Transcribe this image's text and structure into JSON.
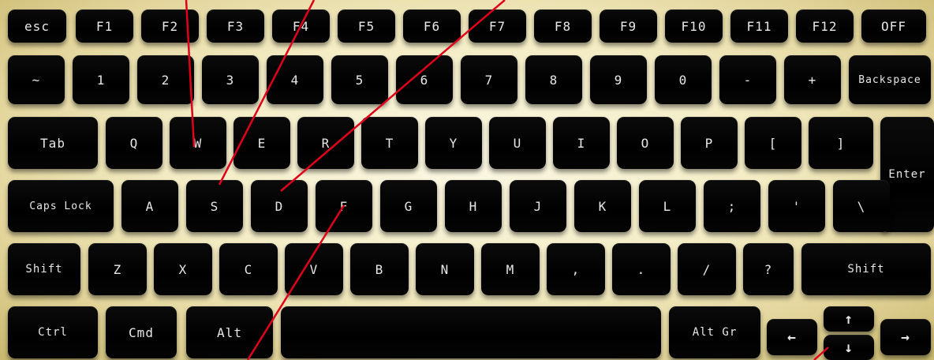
{
  "keyboard": {
    "rows": [
      [
        {
          "id": "esc",
          "label": "esc"
        },
        {
          "id": "f1",
          "label": "F1"
        },
        {
          "id": "f2",
          "label": "F2"
        },
        {
          "id": "f3",
          "label": "F3"
        },
        {
          "id": "f4",
          "label": "F4"
        },
        {
          "id": "f5",
          "label": "F5"
        },
        {
          "id": "f6",
          "label": "F6"
        },
        {
          "id": "f7",
          "label": "F7"
        },
        {
          "id": "f8",
          "label": "F8"
        },
        {
          "id": "f9",
          "label": "F9"
        },
        {
          "id": "f10",
          "label": "F10"
        },
        {
          "id": "f11",
          "label": "F11"
        },
        {
          "id": "f12",
          "label": "F12"
        },
        {
          "id": "off",
          "label": "OFF"
        }
      ],
      [
        {
          "id": "tilde",
          "label": "~"
        },
        {
          "id": "1",
          "label": "1"
        },
        {
          "id": "2",
          "label": "2"
        },
        {
          "id": "3",
          "label": "3"
        },
        {
          "id": "4",
          "label": "4"
        },
        {
          "id": "5",
          "label": "5"
        },
        {
          "id": "6",
          "label": "6"
        },
        {
          "id": "7",
          "label": "7"
        },
        {
          "id": "8",
          "label": "8"
        },
        {
          "id": "9",
          "label": "9"
        },
        {
          "id": "0",
          "label": "0"
        },
        {
          "id": "minus",
          "label": "-"
        },
        {
          "id": "plus",
          "label": "+"
        },
        {
          "id": "backspace",
          "label": "Backspace"
        }
      ],
      [
        {
          "id": "tab",
          "label": "Tab"
        },
        {
          "id": "q",
          "label": "Q"
        },
        {
          "id": "w",
          "label": "W"
        },
        {
          "id": "e",
          "label": "E"
        },
        {
          "id": "r",
          "label": "R"
        },
        {
          "id": "t",
          "label": "T"
        },
        {
          "id": "y",
          "label": "Y"
        },
        {
          "id": "u",
          "label": "U"
        },
        {
          "id": "i",
          "label": "I"
        },
        {
          "id": "o",
          "label": "O"
        },
        {
          "id": "p",
          "label": "P"
        },
        {
          "id": "lbracket",
          "label": "["
        },
        {
          "id": "rbracket",
          "label": "]"
        },
        {
          "id": "enter",
          "label": "Enter"
        }
      ],
      [
        {
          "id": "capslock",
          "label": "Caps Lock"
        },
        {
          "id": "a",
          "label": "A"
        },
        {
          "id": "s",
          "label": "S"
        },
        {
          "id": "d",
          "label": "D"
        },
        {
          "id": "f",
          "label": "F"
        },
        {
          "id": "g",
          "label": "G"
        },
        {
          "id": "h",
          "label": "H"
        },
        {
          "id": "j",
          "label": "J"
        },
        {
          "id": "k",
          "label": "K"
        },
        {
          "id": "l",
          "label": "L"
        },
        {
          "id": "semicolon",
          "label": ";"
        },
        {
          "id": "quote",
          "label": "'"
        },
        {
          "id": "backslash",
          "label": "\\"
        }
      ],
      [
        {
          "id": "shift-left",
          "label": "Shift"
        },
        {
          "id": "z",
          "label": "Z"
        },
        {
          "id": "x",
          "label": "X"
        },
        {
          "id": "c",
          "label": "C"
        },
        {
          "id": "v",
          "label": "V"
        },
        {
          "id": "b",
          "label": "B"
        },
        {
          "id": "n",
          "label": "N"
        },
        {
          "id": "m",
          "label": "M"
        },
        {
          "id": "comma",
          "label": ","
        },
        {
          "id": "period",
          "label": "."
        },
        {
          "id": "slash",
          "label": "/"
        },
        {
          "id": "question",
          "label": "?"
        },
        {
          "id": "shift-right",
          "label": "Shift"
        }
      ],
      [
        {
          "id": "ctrl",
          "label": "Ctrl"
        },
        {
          "id": "cmd",
          "label": "Cmd"
        },
        {
          "id": "alt",
          "label": "Alt"
        },
        {
          "id": "space",
          "label": ""
        },
        {
          "id": "altgr",
          "label": "Alt Gr"
        },
        {
          "id": "arrow-left",
          "label": "←"
        },
        {
          "id": "arrow-up",
          "label": "↑"
        },
        {
          "id": "arrow-down",
          "label": "↓"
        },
        {
          "id": "arrow-right",
          "label": "→"
        }
      ]
    ]
  },
  "annotation_color": "#e0001a"
}
